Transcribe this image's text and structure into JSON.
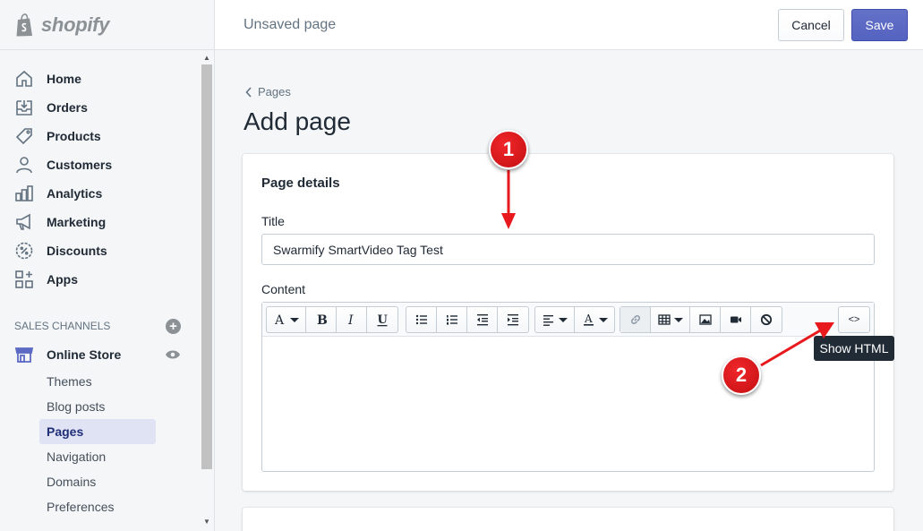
{
  "brand": {
    "name": "shopify"
  },
  "topbar": {
    "title": "Unsaved page",
    "cancel_label": "Cancel",
    "save_label": "Save"
  },
  "sidebar": {
    "items": [
      {
        "label": "Home",
        "icon": "home-icon"
      },
      {
        "label": "Orders",
        "icon": "orders-icon"
      },
      {
        "label": "Products",
        "icon": "tag-icon"
      },
      {
        "label": "Customers",
        "icon": "person-icon"
      },
      {
        "label": "Analytics",
        "icon": "bar-chart-icon"
      },
      {
        "label": "Marketing",
        "icon": "megaphone-icon"
      },
      {
        "label": "Discounts",
        "icon": "discount-icon"
      },
      {
        "label": "Apps",
        "icon": "apps-icon"
      }
    ],
    "channels_heading": "SALES CHANNELS",
    "store_label": "Online Store",
    "subitems": [
      "Themes",
      "Blog posts",
      "Pages",
      "Navigation",
      "Domains",
      "Preferences"
    ],
    "active_subitem": "Pages"
  },
  "main": {
    "breadcrumb": "Pages",
    "heading": "Add page",
    "card_title": "Page details",
    "title_label": "Title",
    "title_value": "Swarmify SmartVideo Tag Test",
    "content_label": "Content",
    "html_button": "<>",
    "tooltip": "Show HTML"
  },
  "annotations": {
    "badge1": "1",
    "badge2": "2"
  },
  "colors": {
    "accent": "#5c6ac4",
    "annotation": "#e8191c",
    "active_nav_bg": "#dfe3f3"
  }
}
